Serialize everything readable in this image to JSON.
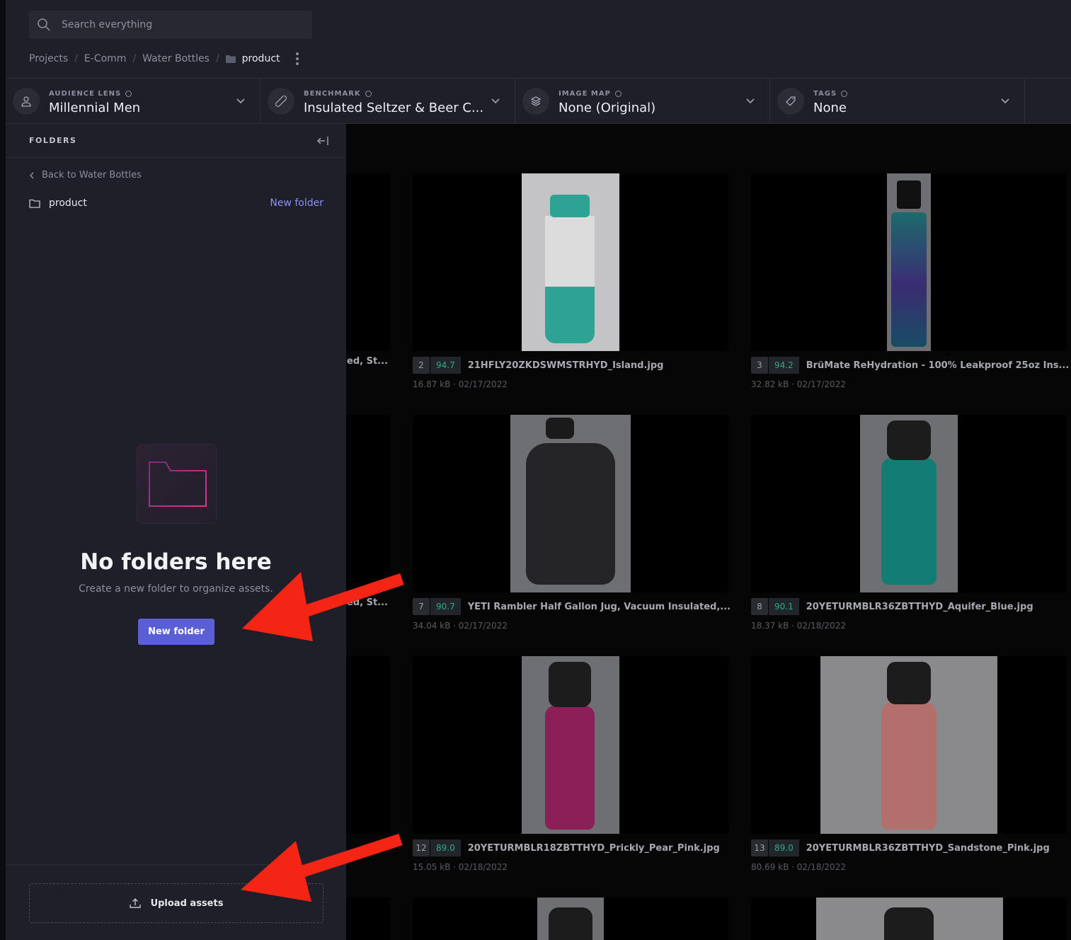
{
  "search": {
    "placeholder": "Search everything"
  },
  "breadcrumb": {
    "items": [
      "Projects",
      "E-Comm",
      "Water Bottles"
    ],
    "current": "product"
  },
  "filters": [
    {
      "label": "AUDIENCE LENS",
      "value": "Millennial Men",
      "icon": "user-icon"
    },
    {
      "label": "BENCHMARK",
      "value": "Insulated Seltzer & Beer C...",
      "icon": "ruler-icon"
    },
    {
      "label": "IMAGE MAP",
      "value": "None (Original)",
      "icon": "layers-icon"
    },
    {
      "label": "TAGS",
      "value": "None",
      "icon": "tag-icon"
    }
  ],
  "sidebar": {
    "title": "FOLDERS",
    "back_label": "Back to Water Bottles",
    "folder_name": "product",
    "new_folder_link": "New folder",
    "empty_title": "No folders here",
    "empty_subtitle": "Create a new folder to organize assets.",
    "new_folder_button": "New folder",
    "upload_label": "Upload assets"
  },
  "assets": [
    {
      "index": "",
      "score": "",
      "name": "ed, St...",
      "size": ""
    },
    {
      "index": "2",
      "score": "94.7",
      "name": "21HFLY20ZKDSWMSTRHYD_Island.jpg",
      "size": "16.87 kB · 02/17/2022",
      "color": "#c9c9cb"
    },
    {
      "index": "3",
      "score": "94.2",
      "name": "BrüMate ReHydration - 100% Leakproof 25oz Ins...",
      "size": "32.82 kB · 02/17/2022",
      "color": "#1b5d5d"
    },
    {
      "index": "",
      "score": "",
      "name": "ed, St...",
      "size": ""
    },
    {
      "index": "7",
      "score": "90.7",
      "name": "YETI Rambler Half Gallon Jug, Vacuum Insulated,...",
      "size": "34.04 kB · 02/17/2022",
      "color": "#262628"
    },
    {
      "index": "8",
      "score": "90.1",
      "name": "20YETURMBLR36ZBTTHYD_Aquifer_Blue.jpg",
      "size": "18.37 kB · 02/18/2022",
      "color": "#147d73"
    },
    {
      "index": "",
      "score": "",
      "name": "",
      "size": ""
    },
    {
      "index": "12",
      "score": "89.0",
      "name": "20YETURMBLR18ZBTTHYD_Prickly_Pear_Pink.jpg",
      "size": "15.05 kB · 02/18/2022",
      "color": "#8a2057"
    },
    {
      "index": "13",
      "score": "89.0",
      "name": "20YETURMBLR36ZBTTHYD_Sandstone_Pink.jpg",
      "size": "80.69 kB · 02/18/2022",
      "color": "#b36f6a"
    }
  ]
}
